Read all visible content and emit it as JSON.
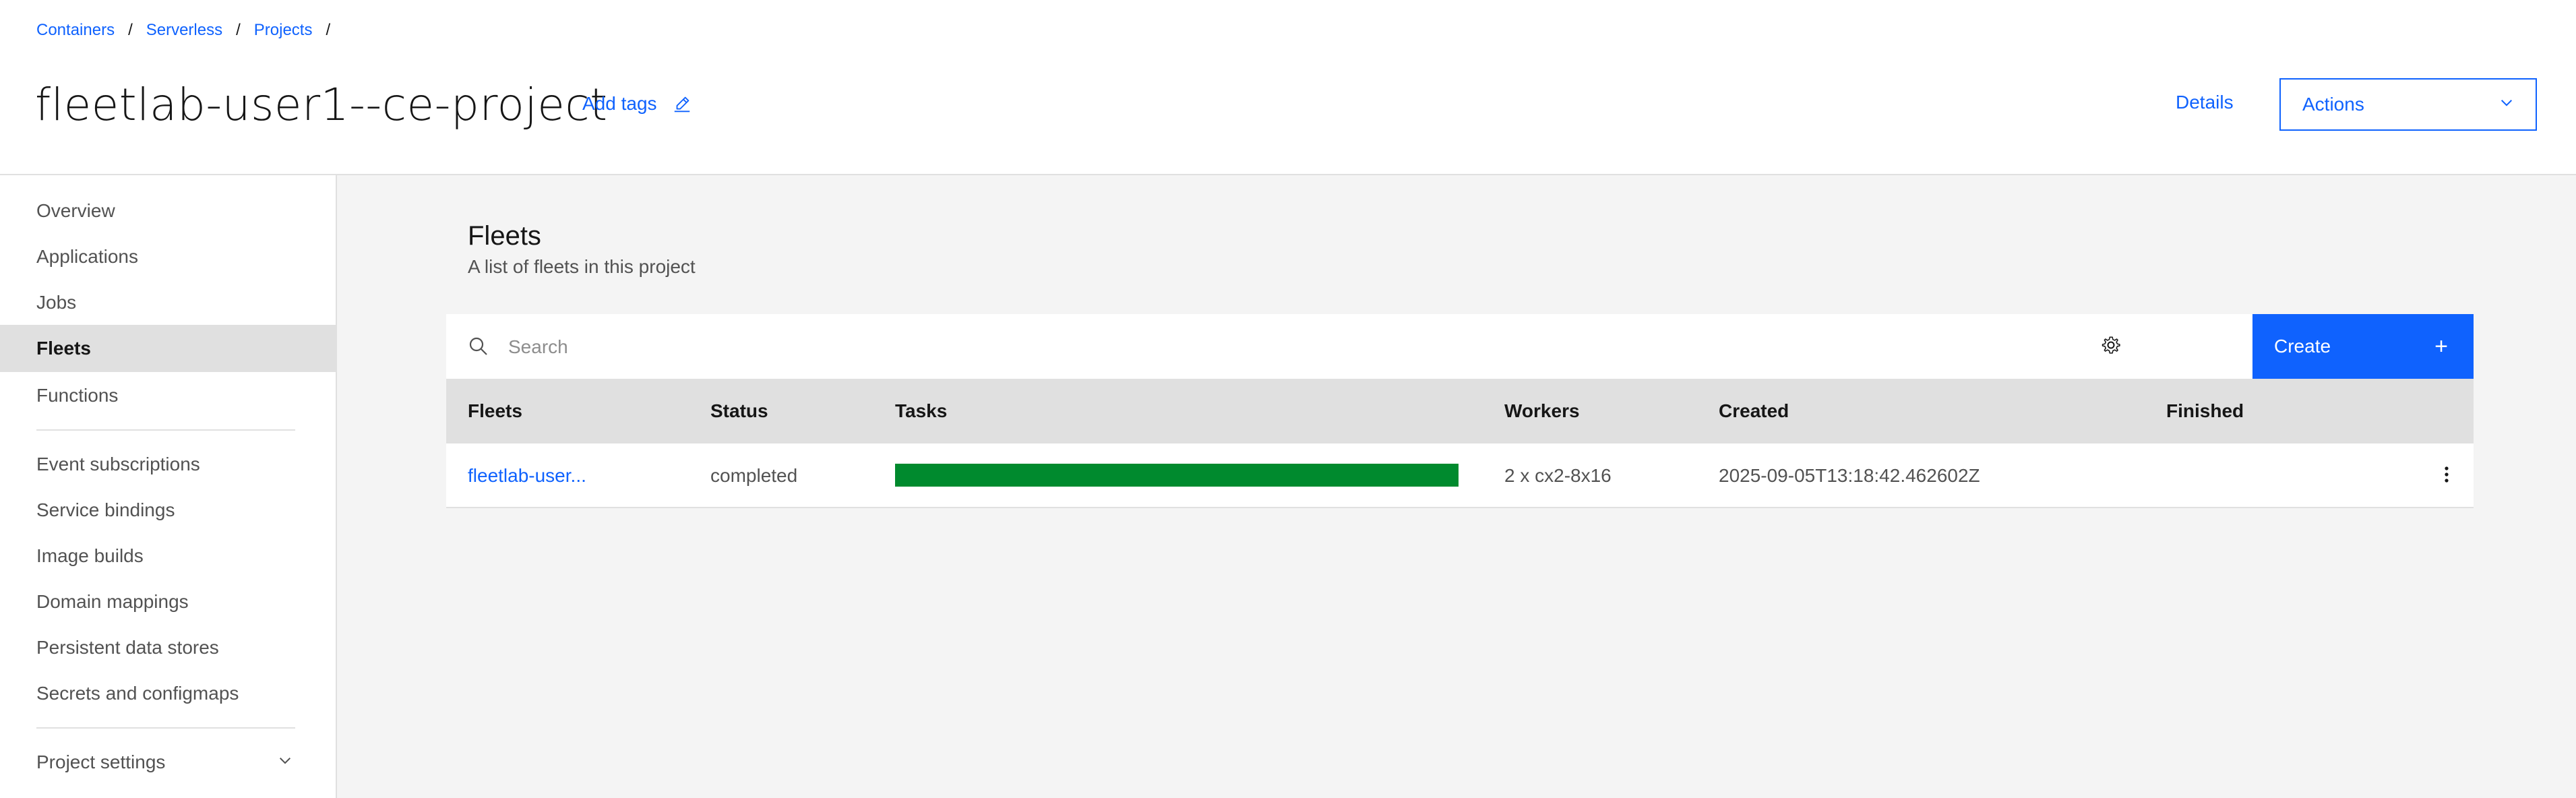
{
  "breadcrumb": [
    {
      "label": "Containers"
    },
    {
      "label": "Serverless"
    },
    {
      "label": "Projects"
    }
  ],
  "breadcrumb_sep": "/",
  "header": {
    "title": "fleetlab-user1--ce-project",
    "add_tags": "Add tags",
    "details": "Details",
    "actions": "Actions"
  },
  "sidebar": {
    "items": [
      {
        "label": "Overview"
      },
      {
        "label": "Applications"
      },
      {
        "label": "Jobs"
      },
      {
        "label": "Fleets",
        "active": true
      },
      {
        "label": "Functions"
      },
      {
        "label": "Event subscriptions"
      },
      {
        "label": "Service bindings"
      },
      {
        "label": "Image builds"
      },
      {
        "label": "Domain mappings"
      },
      {
        "label": "Persistent data stores"
      },
      {
        "label": "Secrets and configmaps"
      }
    ],
    "settings": "Project settings"
  },
  "main": {
    "title": "Fleets",
    "subtitle": "A list of fleets in this project",
    "search_placeholder": "Search",
    "create_label": "Create",
    "create_plus": "+"
  },
  "table": {
    "columns": [
      "Fleets",
      "Status",
      "Tasks",
      "Workers",
      "Created",
      "Finished"
    ],
    "rows": [
      {
        "name": "fleetlab-user...",
        "status": "completed",
        "tasks_progress": 1.0,
        "workers": "2 x cx2-8x16",
        "created": "2025-09-05T13:18:42.462602Z",
        "finished": ""
      }
    ]
  },
  "colors": {
    "link": "#0f62fe",
    "progress": "#008a2e",
    "header_row": "#e0e0e0",
    "main_bg": "#f4f4f4"
  }
}
